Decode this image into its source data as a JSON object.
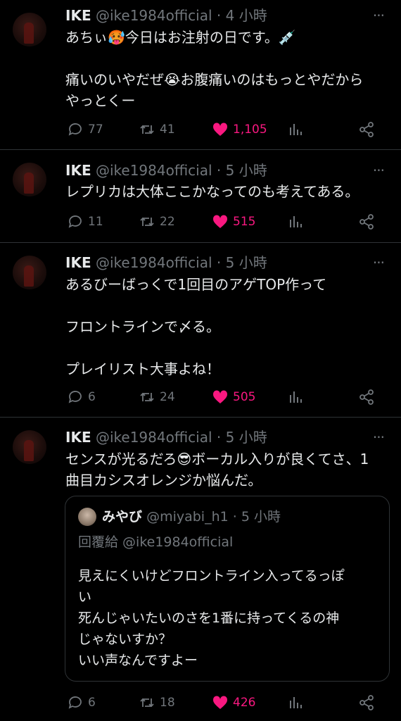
{
  "tweets": [
    {
      "name": "IKE",
      "handle": "@ike1984official",
      "sep": "·",
      "time": "4 小時",
      "lines": [
        "あちぃ🥵今日はお注射の日です。💉",
        "",
        "痛いのいやだぜ😭お腹痛いのはもっとやだから",
        "やっとくー"
      ],
      "replies": "77",
      "retweets": "41",
      "likes": "1,105"
    },
    {
      "name": "IKE",
      "handle": "@ike1984official",
      "sep": "·",
      "time": "5 小時",
      "lines": [
        "レプリカは大体ここかなってのも考えてある。"
      ],
      "replies": "11",
      "retweets": "22",
      "likes": "515"
    },
    {
      "name": "IKE",
      "handle": "@ike1984official",
      "sep": "·",
      "time": "5 小時",
      "lines": [
        "あるびーばっくで1回目のアゲTOP作って",
        "",
        "フロントラインで〆る。",
        "",
        "プレイリスト大事よね！"
      ],
      "replies": "6",
      "retweets": "24",
      "likes": "505"
    },
    {
      "name": "IKE",
      "handle": "@ike1984official",
      "sep": "·",
      "time": "5 小時",
      "lines": [
        "センスが光るだろ😎ボーカル入りが良くてさ、1",
        "曲目カシスオレンジか悩んだ。"
      ],
      "quote": {
        "name": "みやび",
        "handle": "@miyabi_h1",
        "sep": "·",
        "time": "5 小時",
        "reply_to": "回覆給 @ike1984official",
        "lines": [
          "見えにくいけどフロントライン入ってるっぽ",
          "い",
          "死んじゃいたいのさを1番に持ってくるの神",
          "じゃないすか？",
          "いい声なんですよー"
        ]
      },
      "replies": "6",
      "retweets": "18",
      "likes": "426"
    }
  ],
  "colors": {
    "like": "#f91880",
    "muted": "#71767b",
    "border": "#2f3336"
  },
  "icons": [
    "reply-icon",
    "retweet-icon",
    "like-icon",
    "views-icon",
    "share-icon",
    "more-icon"
  ]
}
